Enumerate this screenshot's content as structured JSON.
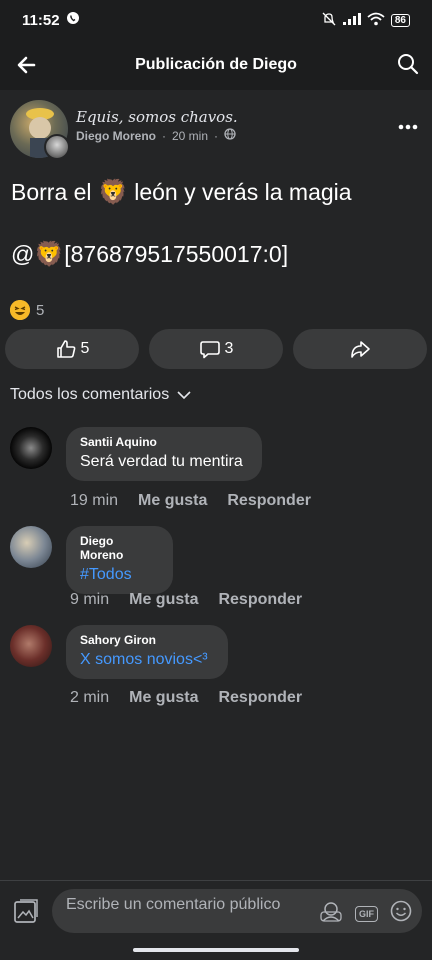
{
  "status_bar": {
    "time": "11:52",
    "battery": "86"
  },
  "app_bar": {
    "title": "Publicación de Diego"
  },
  "post": {
    "page_name": "Equis, somos chavos.",
    "author": "Diego Moreno",
    "time": "20 min",
    "text_before": "Borra el ",
    "text_after": " león y verás la magia",
    "mention_prefix": "@",
    "mention_text": "[876879517550017:0]",
    "reaction_count": "5"
  },
  "actions": {
    "like_count": "5",
    "comment_count": "3"
  },
  "sort": {
    "label": "Todos los comentarios"
  },
  "comments": [
    {
      "name": "Santii Aquino",
      "text": "Será verdad tu mentira",
      "time": "19 min",
      "like": "Me gusta",
      "reply": "Responder"
    },
    {
      "name": "Diego Moreno",
      "text": "#Todos",
      "time": "9 min",
      "like": "Me gusta",
      "reply": "Responder"
    },
    {
      "name": "Sahory Giron",
      "text": "X somos novios<³",
      "time": "2 min",
      "like": "Me gusta",
      "reply": "Responder"
    }
  ],
  "composer": {
    "placeholder": "Escribe un comentario público"
  },
  "colors": {
    "background": "#242526",
    "bubble": "#3a3b3c",
    "link": "#4599ff",
    "muted": "#b0b3b8"
  }
}
